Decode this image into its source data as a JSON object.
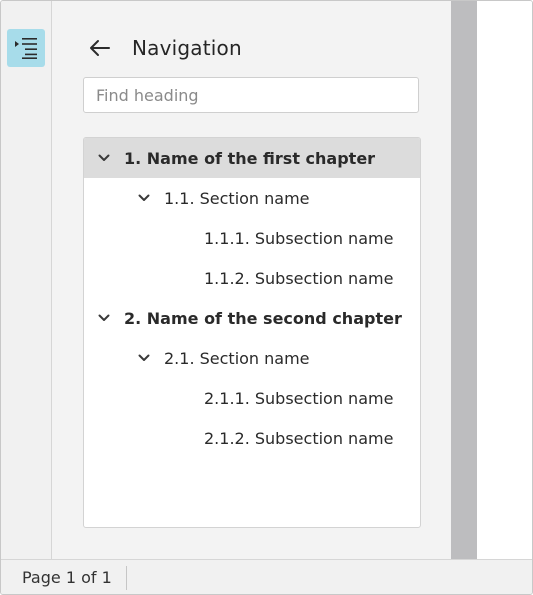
{
  "navigation": {
    "title": "Navigation",
    "search_placeholder": "Find heading",
    "headings": [
      {
        "label": "1. Name of the first chapter",
        "level": 1,
        "selected": true
      },
      {
        "label": "1.1. Section name",
        "level": 2
      },
      {
        "label": "1.1.1. Subsection name",
        "level": 3
      },
      {
        "label": "1.1.2. Subsection name",
        "level": 3
      },
      {
        "label": "2. Name of the second chapter",
        "level": 1
      },
      {
        "label": "2.1. Section name",
        "level": 2
      },
      {
        "label": "2.1.1. Subsection name",
        "level": 3
      },
      {
        "label": "2.1.2. Subsection name",
        "level": 3
      }
    ]
  },
  "status_bar": {
    "page_count": "Page 1 of 1"
  },
  "colors": {
    "toggle_active": "#a7dcea",
    "selected_row": "#dcdcdc",
    "scroll_gutter": "#bdbdbf"
  },
  "icons": {
    "toggle": "navigation-pane-icon",
    "back": "arrow-left-icon",
    "expand": "chevron-down-icon"
  }
}
